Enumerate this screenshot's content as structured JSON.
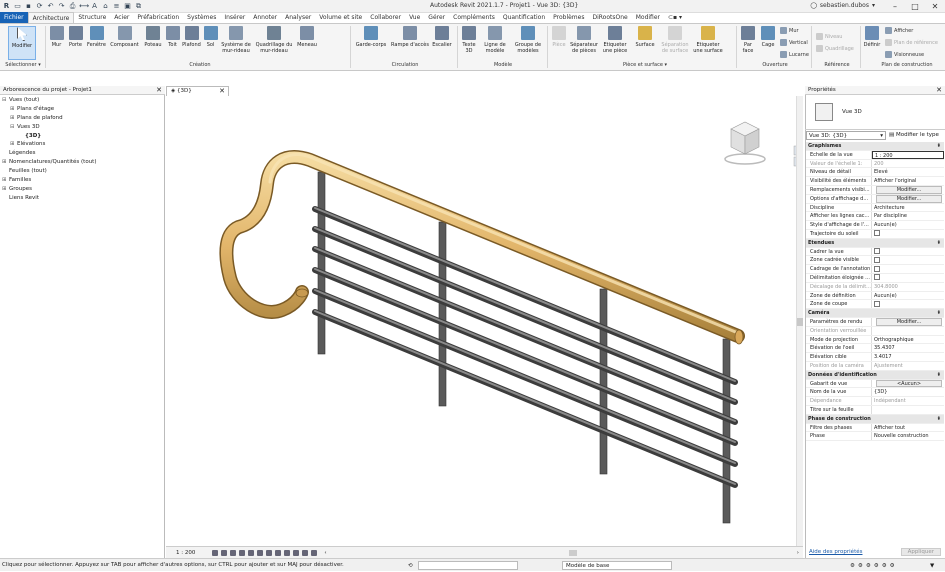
{
  "app": {
    "window_title": "Autodesk Revit 2021.1.7 - Projet1 - Vue 3D: {3D}",
    "user": "sebastien.dubos",
    "quick_access_menu": "⊂▪ ▾"
  },
  "ribbon_tabs": [
    "Fichier",
    "Architecture",
    "Structure",
    "Acier",
    "Préfabrication",
    "Systèmes",
    "Insérer",
    "Annoter",
    "Analyser",
    "Volume et site",
    "Collaborer",
    "Vue",
    "Gérer",
    "Compléments",
    "Quantification",
    "Problèmes",
    "DiRootsOne",
    "Modifier"
  ],
  "ribbon": {
    "select_tool": "Modifier",
    "select_group": "Sélectionner",
    "construction_tools": [
      "Mur",
      "Porte",
      "Fenêtre",
      "Composant",
      "Poteau",
      "Toit",
      "Plafond",
      "Sol",
      "Système de mur-rideau",
      "Quadrillage du mur-rideau",
      "Meneau"
    ],
    "construction_group": "Création",
    "circulation_tools": [
      "Garde-corps",
      "Rampe d'accès",
      "Escalier"
    ],
    "circulation_group": "Circulation",
    "model_tools": [
      "Texte 3D",
      "Ligne de modèle",
      "Groupe de modèles"
    ],
    "model_group": "Modèle",
    "room_tools": [
      "Pièce",
      "Séparateur de pièces",
      "Etiqueter une pièce",
      "Surface",
      "Séparation de surface",
      "Etiqueter une surface"
    ],
    "room_group": "Pièce et surface",
    "opening_tools": [
      "Par face",
      "Cage"
    ],
    "opening_small": [
      "Mur",
      "Vertical",
      "Lucarne"
    ],
    "opening_group": "Ouverture",
    "datum_small": [
      "Niveau",
      "Quadrillage"
    ],
    "datum_group": "Référence",
    "workplane_tool": "Définir",
    "workplane_small": [
      "Afficher",
      "Plan de référence",
      "Visionneuse"
    ],
    "workplane_group": "Plan de construction"
  },
  "browser": {
    "title": "Arborescence du projet - Projet1",
    "items": [
      {
        "label": "Vues (tout)",
        "indent": 0,
        "exp": "⊟"
      },
      {
        "label": "Plans d'étage",
        "indent": 1,
        "exp": "⊞"
      },
      {
        "label": "Plans de plafond",
        "indent": 1,
        "exp": "⊞"
      },
      {
        "label": "Vues 3D",
        "indent": 1,
        "exp": "⊟"
      },
      {
        "label": "{3D}",
        "indent": 2,
        "exp": "",
        "bold": true
      },
      {
        "label": "Elévations",
        "indent": 1,
        "exp": "⊞"
      },
      {
        "label": "Légendes",
        "indent": 0,
        "exp": ""
      },
      {
        "label": "Nomenclatures/Quantités (tout)",
        "indent": 0,
        "exp": "⊞"
      },
      {
        "label": "Feuilles (tout)",
        "indent": 0,
        "exp": ""
      },
      {
        "label": "Familles",
        "indent": 0,
        "exp": "⊞"
      },
      {
        "label": "Groupes",
        "indent": 0,
        "exp": "⊞"
      },
      {
        "label": "Liens Revit",
        "indent": 0,
        "exp": ""
      }
    ]
  },
  "view": {
    "tab_label": "{3D}",
    "scale": "1 : 200",
    "rail_color": "#e2b56a",
    "baluster_color": "#5a5a5a"
  },
  "properties": {
    "title": "Propriétés",
    "type_name": "Vue 3D",
    "selector": "Vue 3D: {3D}",
    "edit_type": "Modifier le type",
    "rows": [
      {
        "group": "Graphismes"
      },
      {
        "k": "Echelle de la vue",
        "v": "1 : 200",
        "input": true
      },
      {
        "k": "Valeur de l'échelle    1:",
        "v": "200",
        "gray": true
      },
      {
        "k": "Niveau de détail",
        "v": "Elevé"
      },
      {
        "k": "Visibilité des éléments",
        "v": "Afficher l'original"
      },
      {
        "k": "Remplacements visibi...",
        "v": "Modifier...",
        "btn": true
      },
      {
        "k": "Options d'affichage d...",
        "v": "Modifier...",
        "btn": true
      },
      {
        "k": "Discipline",
        "v": "Architecture"
      },
      {
        "k": "Afficher les lignes cac...",
        "v": "Par discipline"
      },
      {
        "k": "Style d'affichage de l'...",
        "v": "Aucun(e)"
      },
      {
        "k": "Trajectoire du soleil",
        "chk": true
      },
      {
        "group": "Etendues"
      },
      {
        "k": "Cadrer la vue",
        "chk": true
      },
      {
        "k": "Zone cadrée visible",
        "chk": true
      },
      {
        "k": "Cadrage de l'annotation",
        "chk": true
      },
      {
        "k": "Délimitation éloignée ...",
        "chk": true
      },
      {
        "k": "Décalage de la délimit...",
        "v": "304.8000",
        "gray": true
      },
      {
        "k": "Zone de définition",
        "v": "Aucun(e)"
      },
      {
        "k": "Zone de coupe",
        "chk": true
      },
      {
        "group": "Caméra"
      },
      {
        "k": "Paramètres de rendu",
        "v": "Modifier...",
        "btn": true
      },
      {
        "k": "Orientation verrouillée",
        "v": "",
        "gray": true
      },
      {
        "k": "Mode de projection",
        "v": "Orthographique"
      },
      {
        "k": "Elévation de l'oeil",
        "v": "35.4307"
      },
      {
        "k": "Elévation cible",
        "v": "3.4017"
      },
      {
        "k": "Position de la caméra",
        "v": "Ajustement",
        "gray": true
      },
      {
        "group": "Données d'identification"
      },
      {
        "k": "Gabarit de vue",
        "v": "<Aucun>",
        "btn": true
      },
      {
        "k": "Nom de la vue",
        "v": "{3D}"
      },
      {
        "k": "Dépendance",
        "v": "Indépendant",
        "gray": true
      },
      {
        "k": "Titre sur la feuille",
        "v": ""
      },
      {
        "group": "Phase de construction"
      },
      {
        "k": "Filtre des phases",
        "v": "Afficher tout"
      },
      {
        "k": "Phase",
        "v": "Nouvelle construction"
      }
    ],
    "help": "Aide des propriétés",
    "apply": "Appliquer"
  },
  "status": {
    "message": "Cliquez pour sélectionner. Appuyez sur TAB pour afficher d'autres options, sur CTRL pour ajouter et sur MAJ pour désactiver.",
    "level": ":0",
    "model": "Modèle de base"
  }
}
